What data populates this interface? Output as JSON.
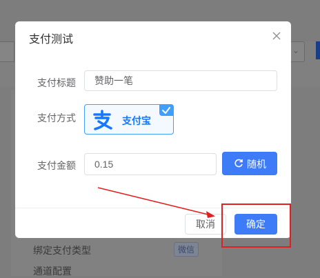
{
  "background": {
    "row1_label": "绑定支付类型",
    "row1_tag": "微信",
    "row2_label": "通道配置"
  },
  "dialog": {
    "title": "支付测试",
    "close_icon": "close-icon",
    "form": {
      "subject_label": "支付标题",
      "subject_value": "赞助一笔",
      "method_label": "支付方式",
      "method_option": "支付宝",
      "method_selected": true,
      "amount_label": "支付金额",
      "amount_value": "0.15",
      "random_button": "随机",
      "random_icon": "refresh-icon"
    },
    "footer": {
      "cancel_label": "取消",
      "confirm_label": "确定"
    }
  },
  "colors": {
    "primary": "#3e7bf7",
    "alipay": "#1677ff",
    "annotation": "#e02020"
  }
}
